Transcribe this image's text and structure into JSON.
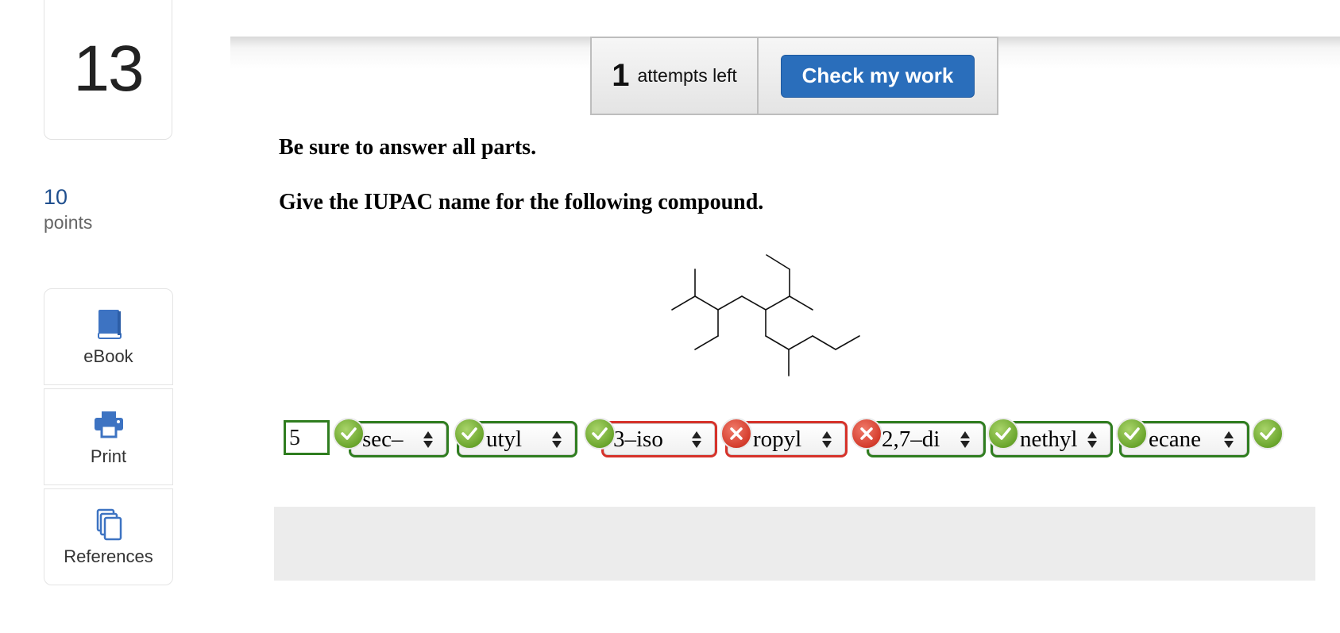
{
  "question": {
    "number": "13",
    "points_value": "10",
    "points_label": "points"
  },
  "tools": [
    {
      "label": "eBook",
      "icon": "book-icon"
    },
    {
      "label": "Print",
      "icon": "printer-icon"
    },
    {
      "label": "References",
      "icon": "copy-documents-icon"
    }
  ],
  "header": {
    "attempts_number": "1",
    "attempts_text": "attempts left",
    "check_label": "Check my work"
  },
  "instructions": {
    "line1": "Be sure to answer all parts.",
    "line2": "Give the IUPAC name for the following compound."
  },
  "answer": {
    "locant_value": "5",
    "parts": [
      {
        "value": "sec–",
        "status": "correct"
      },
      {
        "value": "utyl",
        "status": "correct"
      },
      {
        "value": "3–iso",
        "status": "incorrect"
      },
      {
        "value": "ropyl",
        "status": "incorrect"
      },
      {
        "value": "2,7–di",
        "status": "correct"
      },
      {
        "value": "nethyl",
        "status": "correct"
      },
      {
        "value": "ecane",
        "status": "correct"
      }
    ],
    "marks": [
      "correct",
      "correct",
      "correct",
      "incorrect",
      "incorrect",
      "correct",
      "correct",
      "correct"
    ]
  },
  "colors": {
    "accent": "#2a6ebb",
    "correct": "#2f7d1f",
    "incorrect": "#d6322a",
    "points": "#1f4f8e"
  }
}
